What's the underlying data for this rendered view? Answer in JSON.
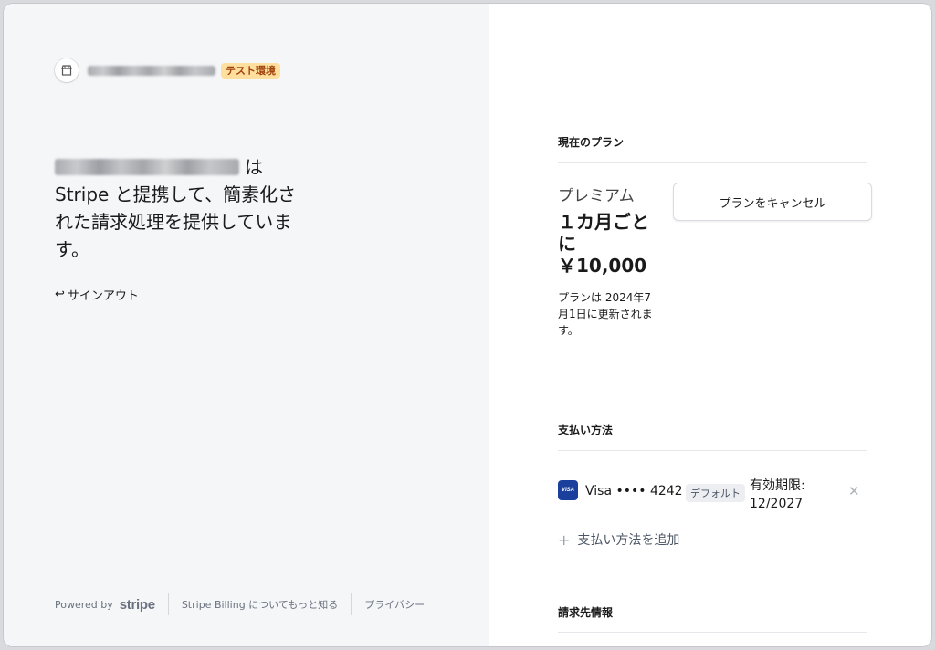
{
  "merchant": {
    "test_badge": "テスト環境"
  },
  "headline": {
    "suffix": "は",
    "body": "Stripe と提携して、簡素化された請求処理を提供しています。"
  },
  "signout": {
    "label": "サインアウト"
  },
  "footer": {
    "powered_by": "Powered by",
    "stripe_logo": "stripe",
    "learn_more": "Stripe Billing についてもっと知る",
    "privacy": "プライバシー"
  },
  "current_plan": {
    "section_title": "現在のプラン",
    "plan_name": "プレミアム",
    "price": "１カ月ごとに￥10,000",
    "renewal": "プランは 2024年7月1日に更新されます。",
    "cancel_label": "プランをキャンセル"
  },
  "payment_method": {
    "section_title": "支払い方法",
    "card_brand_icon": "VISA",
    "card_label": "Visa •••• 4242",
    "default_badge": "デフォルト",
    "expiry": "有効期限: 12/2027",
    "add_label": "支払い方法を追加"
  },
  "billing_info": {
    "section_title": "請求先情報"
  },
  "icons": {
    "store": "store-icon",
    "signout": "return-arrow-icon",
    "remove": "close-icon",
    "add": "plus-icon"
  }
}
